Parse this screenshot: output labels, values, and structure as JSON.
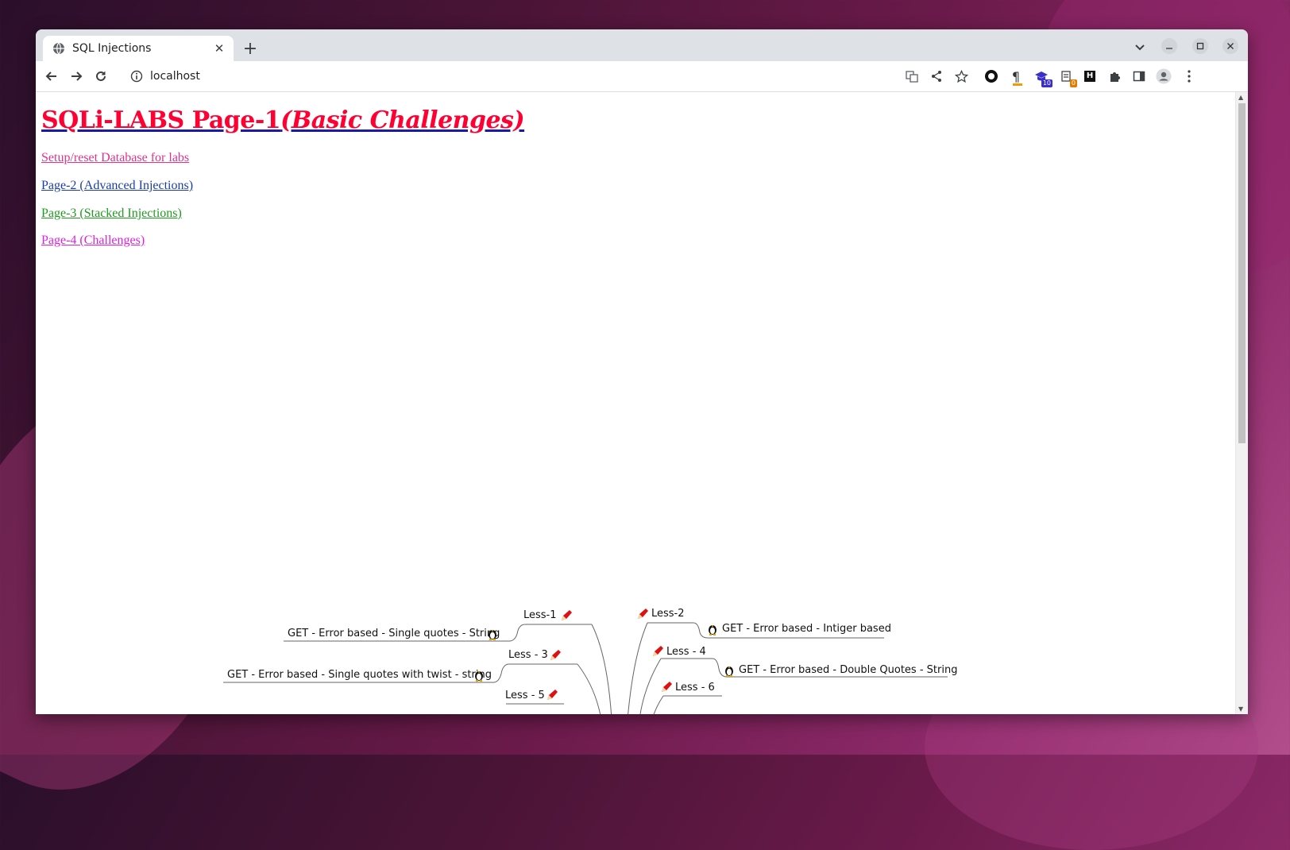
{
  "browser": {
    "tab_title": "SQL Injections",
    "url": "localhost",
    "extension_badges": {
      "ext1": "10",
      "ext2": "0"
    }
  },
  "page": {
    "heading_main": "SQLi-LABS Page-1",
    "heading_sub": "(Basic Challenges)",
    "links": {
      "setup": "Setup/reset Database for labs",
      "page2": "Page-2 (Advanced Injections)",
      "page3": "Page-3 (Stacked Injections)",
      "page4": "Page-4 (Challenges)"
    },
    "colors": {
      "heading": "#ff0033",
      "setup": "#e0338c",
      "page2": "#1c3ea3",
      "page3": "#1f9a1f",
      "page4": "#e020e0"
    }
  },
  "mindmap": {
    "lessons": {
      "less1": "Less-1",
      "less2": "Less-2",
      "less3": "Less - 3",
      "less4": "Less - 4",
      "less5": "Less - 5",
      "less6": "Less - 6"
    },
    "descriptions": {
      "less1": "GET - Error based - Single quotes - String",
      "less2": "GET - Error based - Intiger based",
      "less3": "GET - Error based - Single quotes with twist - string",
      "less4": "GET - Error based - Double Quotes - String"
    }
  }
}
